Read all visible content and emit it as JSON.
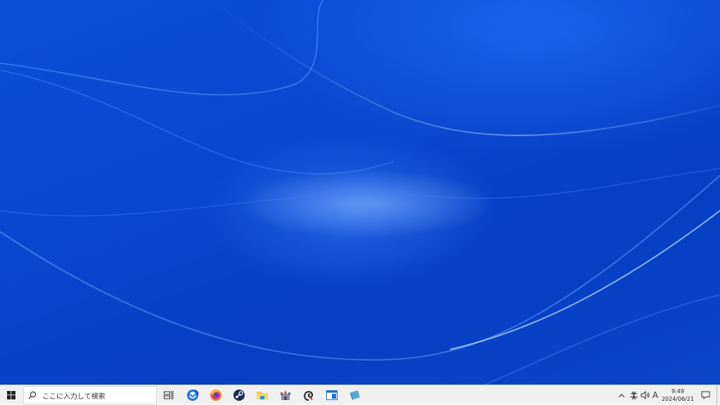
{
  "taskbar": {
    "start": {
      "icon": "windows-logo-icon"
    },
    "search": {
      "placeholder": "ここに入力して検索",
      "icon": "search-icon"
    },
    "task_view": {
      "icon": "task-view-icon"
    },
    "pinned_apps": [
      {
        "name": "thunderbird",
        "icon": "thunderbird-icon"
      },
      {
        "name": "firefox",
        "icon": "firefox-icon"
      },
      {
        "name": "steam",
        "icon": "steam-icon"
      },
      {
        "name": "file-explorer",
        "icon": "folder-icon"
      },
      {
        "name": "app-castle",
        "icon": "castle-icon"
      },
      {
        "name": "app-spiral",
        "icon": "spiral-icon"
      },
      {
        "name": "app-window",
        "icon": "window-app-icon"
      },
      {
        "name": "app-book",
        "icon": "book-icon"
      }
    ],
    "tray": {
      "chevron_icon": "chevron-up-icon",
      "network_icon": "network-icon",
      "volume_icon": "volume-icon",
      "ime_label": "A"
    },
    "clock": {
      "time": "9:49",
      "date": "2024/06/21"
    },
    "notification_icon": "notification-icon"
  }
}
